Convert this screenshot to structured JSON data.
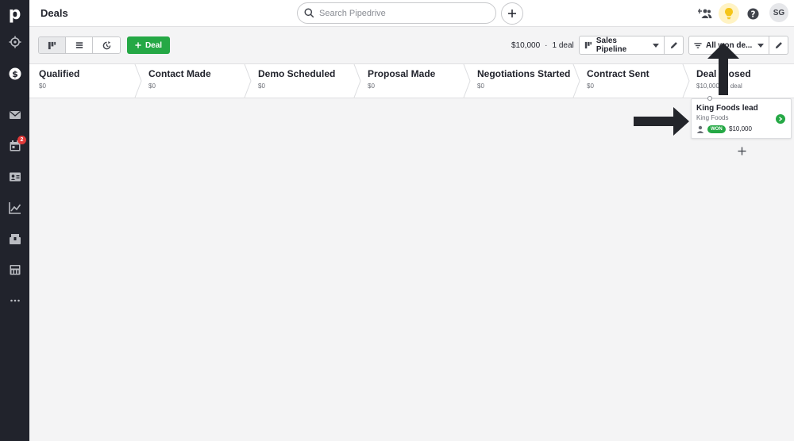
{
  "app": {
    "logo_letter": "p"
  },
  "sidebar": {
    "items": [
      {
        "icon": "target-icon",
        "label": "Leads"
      },
      {
        "icon": "dollar-icon",
        "label": "Deals",
        "active": true
      },
      {
        "icon": "mail-icon",
        "label": "Mail"
      },
      {
        "icon": "calendar-icon",
        "label": "Activities",
        "badge": "2"
      },
      {
        "icon": "contacts-icon",
        "label": "Contacts"
      },
      {
        "icon": "chart-icon",
        "label": "Insights"
      },
      {
        "icon": "box-icon",
        "label": "Products"
      },
      {
        "icon": "store-icon",
        "label": "Marketplace"
      },
      {
        "icon": "more-icon",
        "label": "More"
      }
    ]
  },
  "header": {
    "title": "Deals",
    "search_placeholder": "Search Pipedrive",
    "avatar_initials": "SG"
  },
  "toolbar": {
    "add_deal_label": "Deal",
    "summary_value": "$10,000",
    "summary_separator": "·",
    "summary_count": "1 deal",
    "pipeline_label": "Sales Pipeline",
    "filter_label": "All won de..."
  },
  "stages": [
    {
      "name": "Qualified",
      "sum": "$0"
    },
    {
      "name": "Contact Made",
      "sum": "$0"
    },
    {
      "name": "Demo Scheduled",
      "sum": "$0"
    },
    {
      "name": "Proposal Made",
      "sum": "$0"
    },
    {
      "name": "Negotiations Started",
      "sum": "$0"
    },
    {
      "name": "Contract Sent",
      "sum": "$0"
    },
    {
      "name": "Deal Closed",
      "sum": "$10,000 · 1 deal"
    }
  ],
  "deal_card": {
    "title": "King Foods lead",
    "organization": "King Foods",
    "status": "WON",
    "value": "$10,000"
  },
  "colors": {
    "sidebar": "#21232c",
    "accent_green": "#25a845",
    "badge_red": "#e03a3a",
    "lightbulb_yellow": "#f5c518"
  }
}
